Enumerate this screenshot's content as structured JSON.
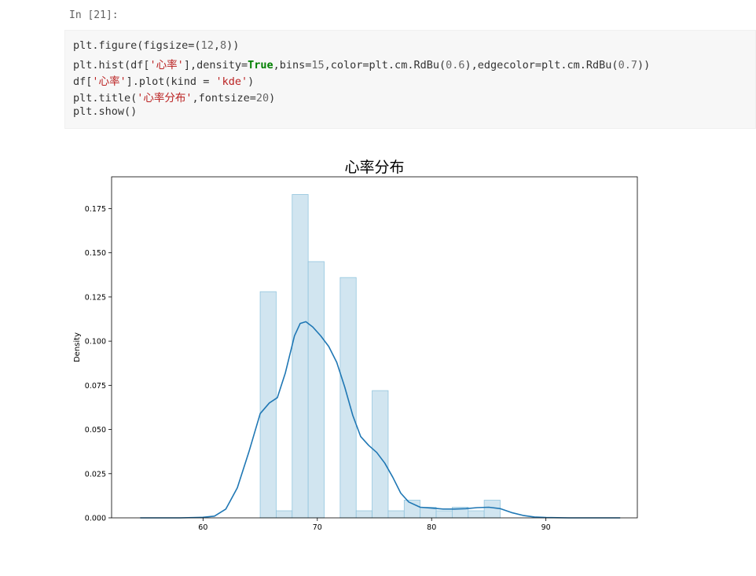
{
  "cell": {
    "prompt": "In [21]:",
    "code_lines": [
      [
        {
          "t": "plt.figure(figsize=("
        },
        {
          "t": "12",
          "c": "n"
        },
        {
          "t": ","
        },
        {
          "t": "8",
          "c": "n"
        },
        {
          "t": "))"
        }
      ],
      [
        {
          "t": "plt.hist(df["
        },
        {
          "t": "'心率'",
          "c": "s"
        },
        {
          "t": "],density="
        },
        {
          "t": "True",
          "c": "k"
        },
        {
          "t": ",bins="
        },
        {
          "t": "15",
          "c": "n"
        },
        {
          "t": ",color=plt.cm.RdBu("
        },
        {
          "t": "0.6",
          "c": "n"
        },
        {
          "t": "),edgecolor=plt.cm.RdBu("
        },
        {
          "t": "0.7",
          "c": "n"
        },
        {
          "t": "))"
        }
      ],
      [
        {
          "t": "df["
        },
        {
          "t": "'心率'",
          "c": "s"
        },
        {
          "t": "].plot(kind = "
        },
        {
          "t": "'kde'",
          "c": "s"
        },
        {
          "t": ")"
        }
      ],
      [
        {
          "t": "plt.title("
        },
        {
          "t": "'心率分布'",
          "c": "s"
        },
        {
          "t": ",fontsize="
        },
        {
          "t": "20",
          "c": "n"
        },
        {
          "t": ")"
        }
      ],
      [
        {
          "t": "plt.show()"
        }
      ]
    ]
  },
  "chart_data": {
    "type": "histogram",
    "title": "心率分布",
    "xlabel": "",
    "ylabel": "Density",
    "xlim": [
      52,
      98
    ],
    "ylim": [
      0,
      0.193
    ],
    "x_ticks": [
      60,
      70,
      80,
      90
    ],
    "y_ticks": [
      0.0,
      0.025,
      0.05,
      0.075,
      0.1,
      0.125,
      0.15,
      0.175
    ],
    "y_tick_labels": [
      "0.000",
      "0.025",
      "0.050",
      "0.075",
      "0.100",
      "0.125",
      "0.150",
      "0.175"
    ],
    "bar_color": "#d1e5f0",
    "edge_color": "#92c5de",
    "kde_color": "#1f77b4",
    "bins": [
      {
        "x0": 65.0,
        "x1": 66.4,
        "value": 0.128
      },
      {
        "x0": 66.4,
        "x1": 67.8,
        "value": 0.004
      },
      {
        "x0": 67.8,
        "x1": 69.2,
        "value": 0.183
      },
      {
        "x0": 69.2,
        "x1": 70.6,
        "value": 0.145
      },
      {
        "x0": 70.6,
        "x1": 72.0,
        "value": 0.0
      },
      {
        "x0": 72.0,
        "x1": 73.4,
        "value": 0.136
      },
      {
        "x0": 73.4,
        "x1": 74.8,
        "value": 0.004
      },
      {
        "x0": 74.8,
        "x1": 76.2,
        "value": 0.072
      },
      {
        "x0": 76.2,
        "x1": 77.6,
        "value": 0.004
      },
      {
        "x0": 77.6,
        "x1": 79.0,
        "value": 0.01
      },
      {
        "x0": 79.0,
        "x1": 80.4,
        "value": 0.006
      },
      {
        "x0": 80.4,
        "x1": 81.8,
        "value": 0.004
      },
      {
        "x0": 81.8,
        "x1": 83.2,
        "value": 0.006
      },
      {
        "x0": 83.2,
        "x1": 84.6,
        "value": 0.004
      },
      {
        "x0": 84.6,
        "x1": 86.0,
        "value": 0.01
      }
    ],
    "kde": {
      "x": [
        54.5,
        58,
        60,
        61,
        62,
        63,
        64,
        65,
        65.8,
        66.5,
        67.2,
        68,
        68.5,
        69,
        69.6,
        70.3,
        71,
        71.7,
        72.4,
        73.1,
        73.8,
        74.5,
        75.2,
        75.9,
        76.6,
        77.3,
        78,
        79,
        80,
        81,
        82,
        83,
        84,
        85,
        86,
        87,
        88,
        89,
        90,
        92,
        94,
        96.5
      ],
      "y": [
        0.0,
        0.0,
        0.0003,
        0.001,
        0.005,
        0.017,
        0.037,
        0.059,
        0.065,
        0.068,
        0.082,
        0.103,
        0.11,
        0.111,
        0.108,
        0.103,
        0.097,
        0.088,
        0.074,
        0.058,
        0.046,
        0.041,
        0.037,
        0.031,
        0.023,
        0.014,
        0.009,
        0.006,
        0.0055,
        0.005,
        0.005,
        0.0052,
        0.0058,
        0.006,
        0.0052,
        0.003,
        0.0014,
        0.0005,
        0.0002,
        0.0,
        0.0,
        0.0
      ]
    }
  }
}
